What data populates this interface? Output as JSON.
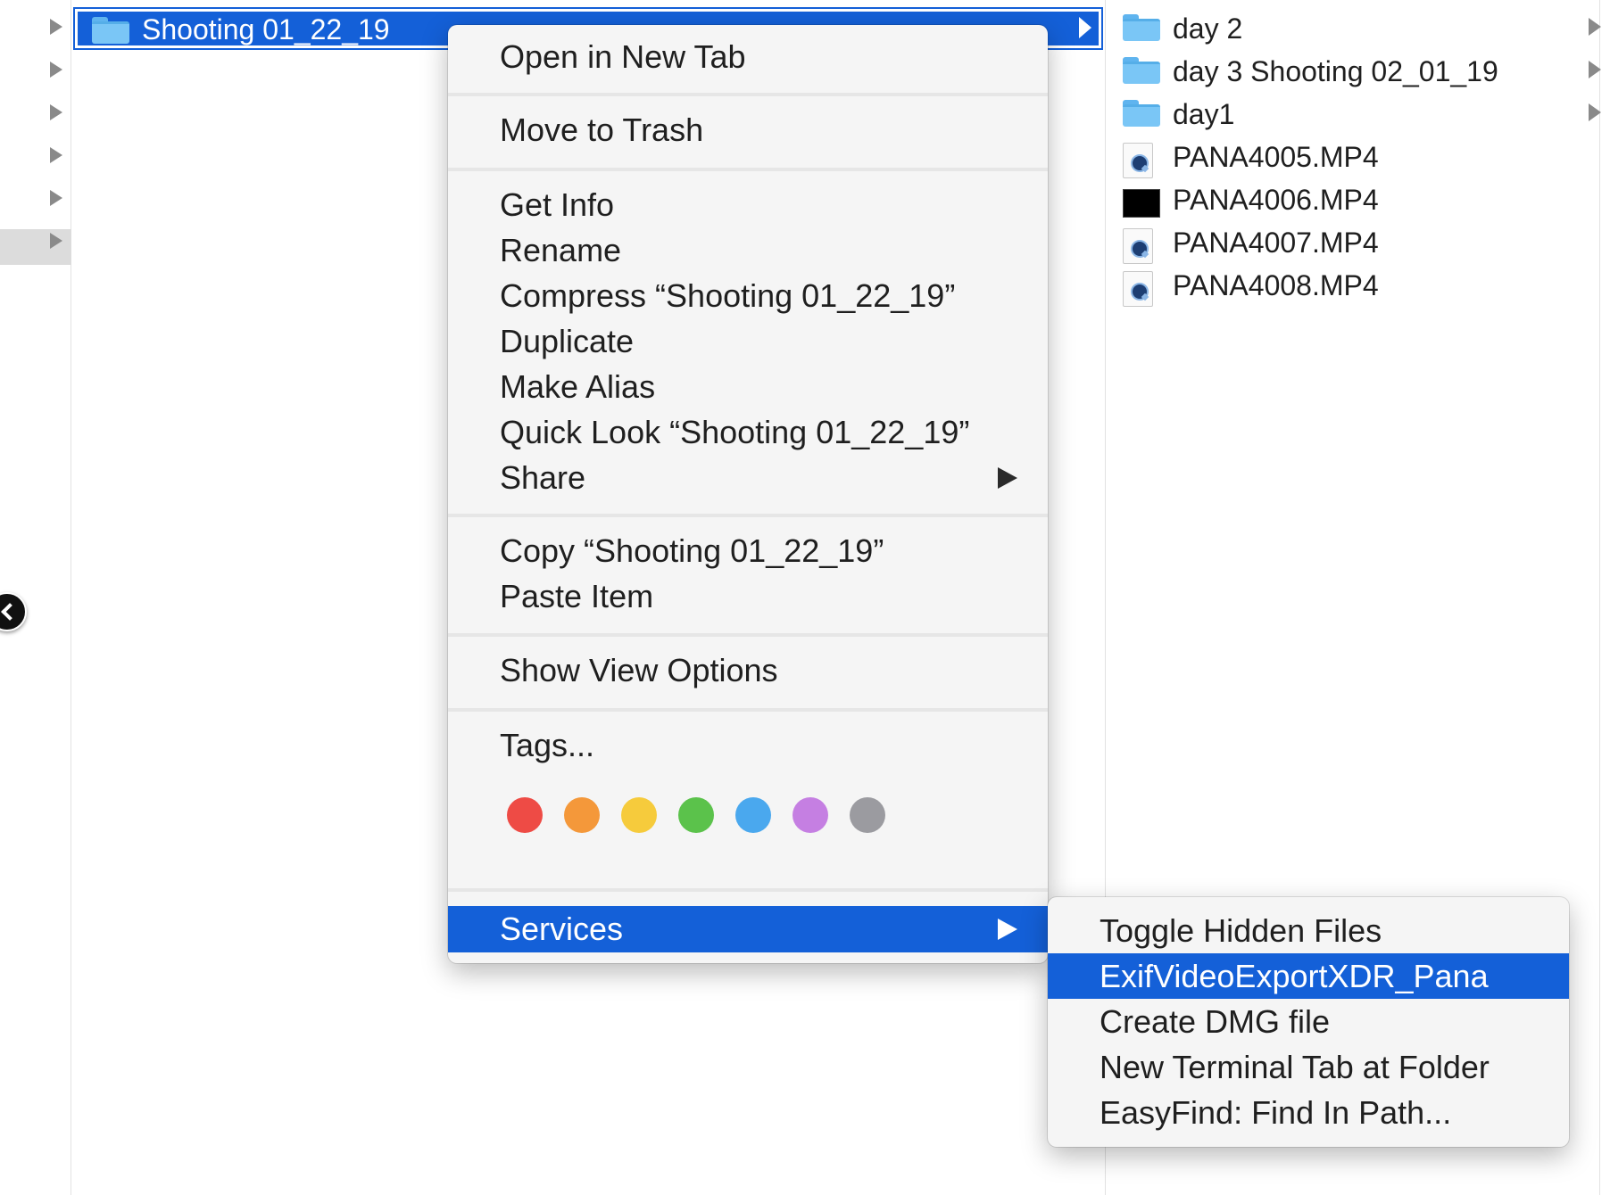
{
  "colors": {
    "selection": "#1460d8",
    "tag_colors": [
      "#ee4b45",
      "#f4983a",
      "#f6cb3c",
      "#5bc24b",
      "#4aa8ee",
      "#c57fe2",
      "#9b9ba0"
    ]
  },
  "finder": {
    "selected_folder": "Shooting 01_22_19",
    "files": [
      {
        "name": "day  2",
        "icon": "folder-icon",
        "has_children": true
      },
      {
        "name": "day 3 Shooting 02_01_19",
        "icon": "folder-icon",
        "has_children": true
      },
      {
        "name": "day1",
        "icon": "folder-icon",
        "has_children": true
      },
      {
        "name": "PANA4005.MP4",
        "icon": "quicktime-file-icon",
        "has_children": false
      },
      {
        "name": "PANA4006.MP4",
        "icon": "video-thumbnail-icon",
        "has_children": false
      },
      {
        "name": "PANA4007.MP4",
        "icon": "quicktime-file-icon",
        "has_children": false
      },
      {
        "name": "PANA4008.MP4",
        "icon": "quicktime-file-icon",
        "has_children": false
      }
    ]
  },
  "context_menu": {
    "open_in_new_tab": "Open in New Tab",
    "move_to_trash": "Move to Trash",
    "get_info": "Get Info",
    "rename": "Rename",
    "compress": "Compress “Shooting 01_22_19”",
    "duplicate": "Duplicate",
    "make_alias": "Make Alias",
    "quick_look": "Quick Look “Shooting 01_22_19”",
    "share": "Share",
    "copy": "Copy “Shooting 01_22_19”",
    "paste_item": "Paste Item",
    "show_view_options": "Show View Options",
    "tags": "Tags...",
    "services": "Services"
  },
  "services_menu": {
    "items": [
      "Toggle Hidden Files",
      "ExifVideoExportXDR_Pana",
      "Create DMG file",
      "New Terminal Tab at Folder",
      "EasyFind: Find In Path..."
    ],
    "highlighted_index": 1
  }
}
